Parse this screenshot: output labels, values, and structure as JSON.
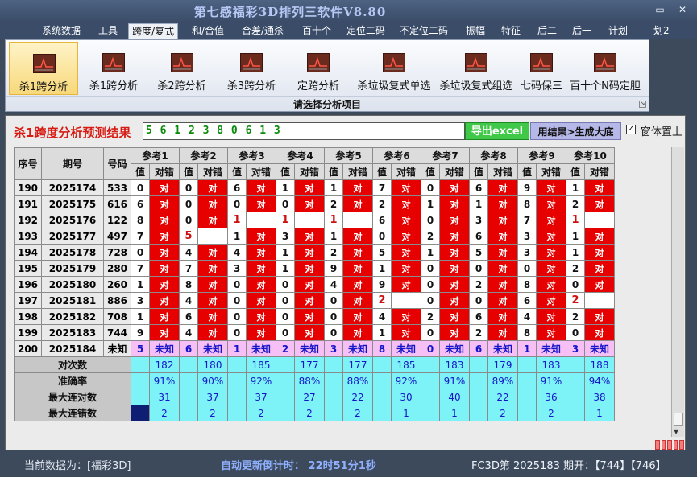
{
  "app": {
    "title": "第七感福彩3D排列三软件V8.80"
  },
  "window_controls": [
    "-",
    "▭",
    "✕"
  ],
  "menu": [
    "系统数据",
    "工具",
    "跨度/复式",
    "和/合值",
    "合差/通杀",
    "百十个",
    "定位二码",
    "不定位二码",
    "振幅",
    "特征",
    "后二",
    "后一",
    "计划",
    "划2"
  ],
  "menu_active": 2,
  "ribbon": {
    "buttons": [
      "杀1跨分析",
      "杀1跨分析",
      "杀2跨分析",
      "杀3跨分析",
      "定跨分析",
      "杀垃圾复式单选",
      "杀垃圾复式组选",
      "七码保三",
      "百十个N码定胆"
    ],
    "selected": 0,
    "group_label": "请选择分析项目"
  },
  "panel": {
    "title": "杀1跨度分析预测结果",
    "prediction": "5 6 1 2 3 8 0 6 1 3",
    "export_button": "导出excel",
    "generate_button": "用结果>生成大底",
    "topmost_label": "窗体置上",
    "topmost_checked": true
  },
  "table": {
    "headers": {
      "seq": "序号",
      "period": "期号",
      "code": "号码",
      "ref_names": [
        "参考1",
        "参考2",
        "参考3",
        "参考4",
        "参考5",
        "参考6",
        "参考7",
        "参考8",
        "参考9",
        "参考10"
      ],
      "val": "值",
      "res": "对错"
    },
    "rows": [
      {
        "seq": "190",
        "period": "2025174",
        "code": "533",
        "refs": [
          [
            "0",
            "对"
          ],
          [
            "0",
            "对"
          ],
          [
            "6",
            "对"
          ],
          [
            "1",
            "对"
          ],
          [
            "1",
            "对"
          ],
          [
            "7",
            "对"
          ],
          [
            "0",
            "对"
          ],
          [
            "6",
            "对"
          ],
          [
            "9",
            "对"
          ],
          [
            "1",
            "对"
          ]
        ]
      },
      {
        "seq": "191",
        "period": "2025175",
        "code": "616",
        "refs": [
          [
            "6",
            "对"
          ],
          [
            "0",
            "对"
          ],
          [
            "0",
            "对"
          ],
          [
            "0",
            "对"
          ],
          [
            "2",
            "对"
          ],
          [
            "2",
            "对"
          ],
          [
            "1",
            "对"
          ],
          [
            "1",
            "对"
          ],
          [
            "8",
            "对"
          ],
          [
            "2",
            "对"
          ]
        ]
      },
      {
        "seq": "192",
        "period": "2025176",
        "code": "122",
        "refs": [
          [
            "8",
            "对"
          ],
          [
            "0",
            "对"
          ],
          [
            "1",
            ""
          ],
          [
            "1",
            ""
          ],
          [
            "1",
            ""
          ],
          [
            "6",
            "对"
          ],
          [
            "0",
            "对"
          ],
          [
            "3",
            "对"
          ],
          [
            "7",
            "对"
          ],
          [
            "1",
            ""
          ]
        ]
      },
      {
        "seq": "193",
        "period": "2025177",
        "code": "497",
        "refs": [
          [
            "7",
            "对"
          ],
          [
            "5",
            ""
          ],
          [
            "1",
            "对"
          ],
          [
            "3",
            "对"
          ],
          [
            "1",
            "对"
          ],
          [
            "0",
            "对"
          ],
          [
            "2",
            "对"
          ],
          [
            "6",
            "对"
          ],
          [
            "3",
            "对"
          ],
          [
            "1",
            "对"
          ]
        ]
      },
      {
        "seq": "194",
        "period": "2025178",
        "code": "728",
        "refs": [
          [
            "0",
            "对"
          ],
          [
            "4",
            "对"
          ],
          [
            "4",
            "对"
          ],
          [
            "1",
            "对"
          ],
          [
            "2",
            "对"
          ],
          [
            "5",
            "对"
          ],
          [
            "1",
            "对"
          ],
          [
            "5",
            "对"
          ],
          [
            "3",
            "对"
          ],
          [
            "1",
            "对"
          ]
        ]
      },
      {
        "seq": "195",
        "period": "2025179",
        "code": "280",
        "refs": [
          [
            "7",
            "对"
          ],
          [
            "7",
            "对"
          ],
          [
            "3",
            "对"
          ],
          [
            "1",
            "对"
          ],
          [
            "9",
            "对"
          ],
          [
            "1",
            "对"
          ],
          [
            "0",
            "对"
          ],
          [
            "0",
            "对"
          ],
          [
            "0",
            "对"
          ],
          [
            "2",
            "对"
          ]
        ]
      },
      {
        "seq": "196",
        "period": "2025180",
        "code": "260",
        "refs": [
          [
            "1",
            "对"
          ],
          [
            "8",
            "对"
          ],
          [
            "0",
            "对"
          ],
          [
            "0",
            "对"
          ],
          [
            "4",
            "对"
          ],
          [
            "9",
            "对"
          ],
          [
            "0",
            "对"
          ],
          [
            "2",
            "对"
          ],
          [
            "8",
            "对"
          ],
          [
            "0",
            "对"
          ]
        ]
      },
      {
        "seq": "197",
        "period": "2025181",
        "code": "886",
        "refs": [
          [
            "3",
            "对"
          ],
          [
            "4",
            "对"
          ],
          [
            "0",
            "对"
          ],
          [
            "0",
            "对"
          ],
          [
            "0",
            "对"
          ],
          [
            "2",
            ""
          ],
          [
            "0",
            "对"
          ],
          [
            "0",
            "对"
          ],
          [
            "6",
            "对"
          ],
          [
            "2",
            ""
          ]
        ]
      },
      {
        "seq": "198",
        "period": "2025182",
        "code": "708",
        "refs": [
          [
            "1",
            "对"
          ],
          [
            "6",
            "对"
          ],
          [
            "0",
            "对"
          ],
          [
            "0",
            "对"
          ],
          [
            "0",
            "对"
          ],
          [
            "4",
            "对"
          ],
          [
            "2",
            "对"
          ],
          [
            "6",
            "对"
          ],
          [
            "4",
            "对"
          ],
          [
            "2",
            "对"
          ]
        ]
      },
      {
        "seq": "199",
        "period": "2025183",
        "code": "744",
        "refs": [
          [
            "9",
            "对"
          ],
          [
            "4",
            "对"
          ],
          [
            "0",
            "对"
          ],
          [
            "0",
            "对"
          ],
          [
            "0",
            "对"
          ],
          [
            "1",
            "对"
          ],
          [
            "0",
            "对"
          ],
          [
            "2",
            "对"
          ],
          [
            "8",
            "对"
          ],
          [
            "0",
            "对"
          ]
        ]
      }
    ],
    "pred_row": {
      "seq": "200",
      "period": "2025184",
      "code": "未知",
      "refs": [
        [
          "5",
          "未知"
        ],
        [
          "6",
          "未知"
        ],
        [
          "1",
          "未知"
        ],
        [
          "2",
          "未知"
        ],
        [
          "3",
          "未知"
        ],
        [
          "8",
          "未知"
        ],
        [
          "0",
          "未知"
        ],
        [
          "6",
          "未知"
        ],
        [
          "1",
          "未知"
        ],
        [
          "3",
          "未知"
        ]
      ]
    },
    "stats": [
      {
        "label": "对次数",
        "values": [
          "182",
          "180",
          "185",
          "177",
          "177",
          "185",
          "183",
          "179",
          "183",
          "188"
        ]
      },
      {
        "label": "准确率",
        "values": [
          "91%",
          "90%",
          "92%",
          "88%",
          "88%",
          "92%",
          "91%",
          "89%",
          "91%",
          "94%"
        ]
      },
      {
        "label": "最大连对数",
        "values": [
          "31",
          "37",
          "37",
          "27",
          "22",
          "30",
          "40",
          "22",
          "36",
          "38"
        ]
      },
      {
        "label": "最大连错数",
        "values": [
          "2",
          "2",
          "2",
          "2",
          "2",
          "1",
          "1",
          "2",
          "2",
          "1"
        ]
      }
    ]
  },
  "status": {
    "current": "当前数据为：[福彩3D]",
    "countdown": "自动更新倒计时：  22时51分1秒",
    "draw": "FC3D第 2025183 期开：【744】【746】"
  },
  "colors": {
    "hit": "#e60000",
    "predict_row": "#f6bff6",
    "stats": "#7df3f8",
    "title_red": "#d81b12",
    "excel_green": "#40c848"
  }
}
